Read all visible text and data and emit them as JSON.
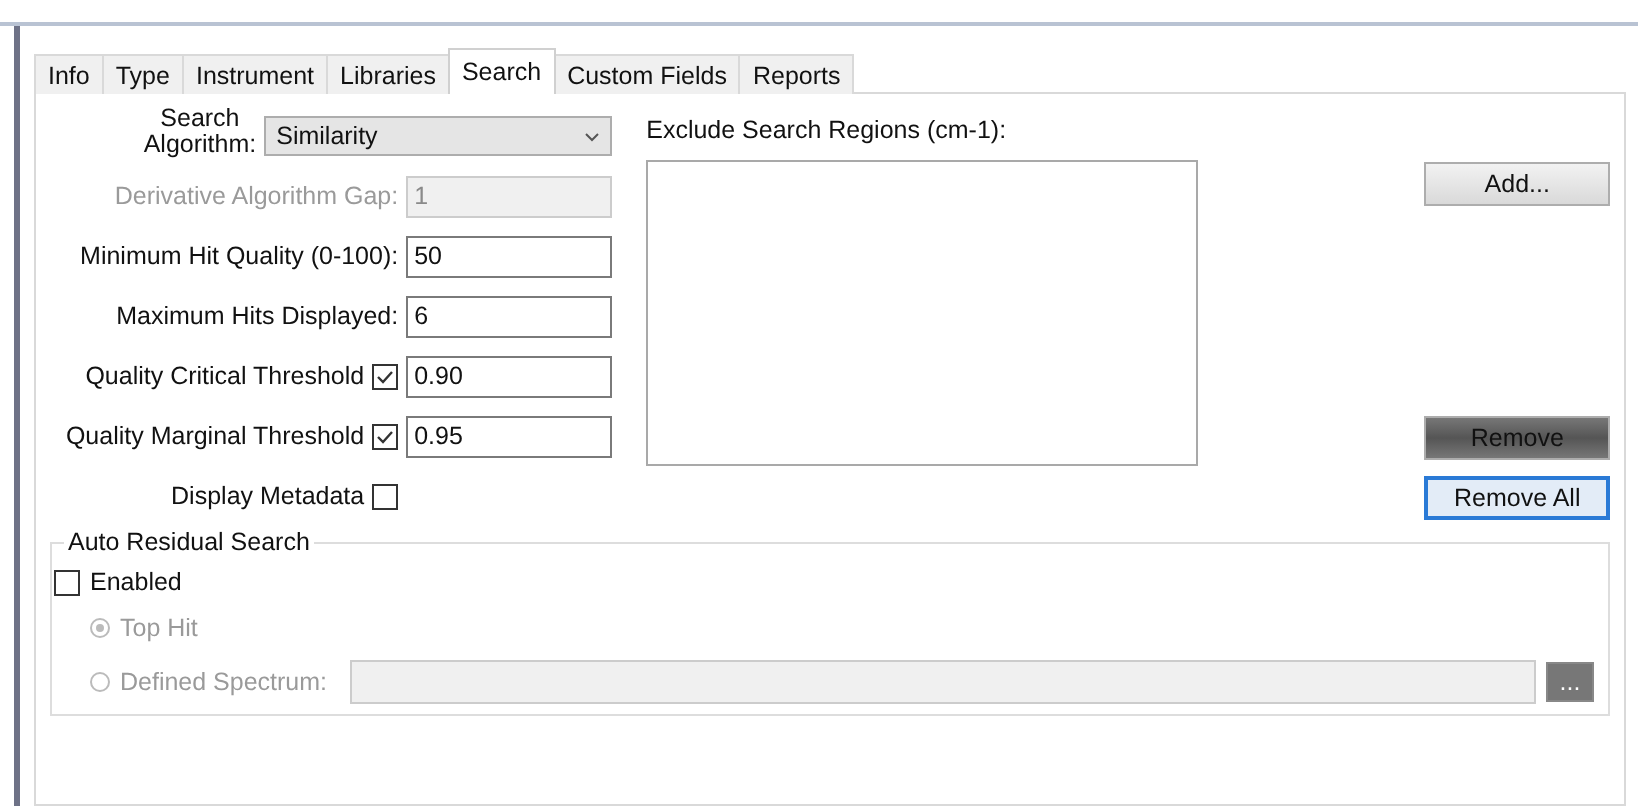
{
  "tabs": [
    {
      "label": "Info",
      "selected": false
    },
    {
      "label": "Type",
      "selected": false
    },
    {
      "label": "Instrument",
      "selected": false
    },
    {
      "label": "Libraries",
      "selected": false
    },
    {
      "label": "Search",
      "selected": true
    },
    {
      "label": "Custom Fields",
      "selected": false
    },
    {
      "label": "Reports",
      "selected": false
    }
  ],
  "search_algorithm": {
    "label_lines": [
      "Search",
      "Algorithm:"
    ],
    "value": "Similarity"
  },
  "fields": [
    {
      "kind": "input",
      "label": "Derivative Algorithm Gap:",
      "value": "1",
      "disabled": true
    },
    {
      "kind": "input",
      "label": "Minimum Hit Quality (0-100):",
      "value": "50",
      "disabled": false
    },
    {
      "kind": "input",
      "label": "Maximum Hits Displayed:",
      "value": "6",
      "disabled": false
    },
    {
      "kind": "checkbox-input",
      "label": "Quality Critical Threshold",
      "checked": true,
      "value": "0.90",
      "disabled": false
    },
    {
      "kind": "checkbox-input",
      "label": "Quality Marginal Threshold",
      "checked": true,
      "value": "0.95",
      "disabled": false
    },
    {
      "kind": "checkbox",
      "label": "Display Metadata",
      "checked": false,
      "disabled": false
    }
  ],
  "exclude_regions": {
    "label": "Exclude Search Regions (cm-1):"
  },
  "buttons": [
    {
      "label": "Add...",
      "kind": "normal"
    },
    {
      "label": "Remove",
      "kind": "dark"
    },
    {
      "label": "Remove All",
      "kind": "focused"
    }
  ],
  "auto_residual": {
    "title": "Auto Residual Search",
    "enabled": {
      "label": "Enabled",
      "checked": false
    },
    "options": [
      {
        "label": "Top Hit",
        "selected": true,
        "disabled": true
      },
      {
        "label": "Defined Spectrum:",
        "selected": false,
        "disabled": true
      }
    ],
    "spectrum_field": {
      "disabled": true
    },
    "browse_button": {
      "label": "..."
    }
  }
}
